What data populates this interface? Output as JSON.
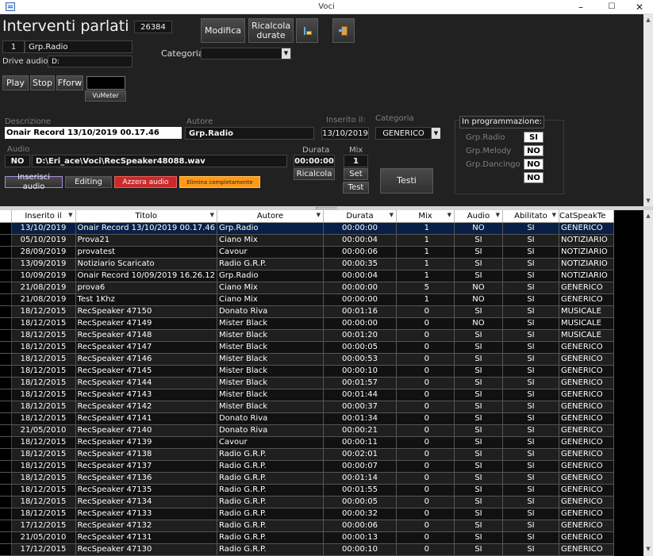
{
  "window": {
    "title": "Voci",
    "min_label": "–",
    "max_label": "☐",
    "close_label": "✕"
  },
  "header": {
    "title": "Interventi parlati",
    "count": "26384",
    "group_id": "1",
    "group_name": "Grp.Radio",
    "drive_label": "Drive audio:",
    "drive_value": "D:",
    "category_label": "Categoria:",
    "category_value": ""
  },
  "toolbar": {
    "edit_label": "Modifica",
    "recalc_label": "Ricalcola durate",
    "sort_icon": "sort-icon",
    "exit_icon": "exit-icon"
  },
  "player": {
    "play": "Play",
    "stop": "Stop",
    "fforw": "Fforw",
    "vumeter": "VuMeter"
  },
  "detail": {
    "description_label": "Descrizione",
    "description_value": "Onair Record 13/10/2019 00.17.46",
    "author_label": "Autore",
    "author_value": "Grp.Radio",
    "inserted_label": "Inserito il:",
    "inserted_value": "13/10/2019",
    "category_label": "Categoria",
    "category_value": "GENERICO",
    "audio_label": "Audio",
    "audio_flag": "NO",
    "audio_path": "D:\\Eri_ace\\Voci\\RecSpeaker48088.wav",
    "duration_label": "Durata",
    "duration_value": "00:00:00",
    "recalc_label": "Ricalcola",
    "mix_label": "Mix",
    "mix_value": "1",
    "set_label": "Set",
    "test_label": "Test",
    "tests_label": "Testi"
  },
  "actions": {
    "insert_audio": "Inserisci audio",
    "editing": "Editing",
    "reset_audio": "Azzera audio",
    "delete_all": "Elimina completamente"
  },
  "programming": {
    "title": "In programmazione:",
    "rows": [
      {
        "name": "Grp.Radio",
        "value": "SI"
      },
      {
        "name": "Grp.Melody",
        "value": "NO"
      },
      {
        "name": "Grp.Dancingo",
        "value": "NO"
      },
      {
        "name": "",
        "value": "NO"
      }
    ]
  },
  "grid": {
    "columns": [
      "Inserito il",
      "Titolo",
      "Autore",
      "Durata",
      "Mix",
      "Audio",
      "Abilitato",
      "CatSpeakTe"
    ],
    "rows": [
      [
        "13/10/2019",
        "Onair Record 13/10/2019 00.17.46",
        "Grp.Radio",
        "00:00:00",
        "1",
        "NO",
        "SI",
        "GENERICO"
      ],
      [
        "05/10/2019",
        "Prova21",
        "Ciano Mix",
        "00:00:04",
        "1",
        "SI",
        "SI",
        "NOTIZIARIO"
      ],
      [
        "28/09/2019",
        "provatest",
        "Cavour",
        "00:00:06",
        "1",
        "SI",
        "SI",
        "NOTIZIARIO"
      ],
      [
        "13/09/2019",
        "Notiziario Scaricato",
        "Radio G.R.P.",
        "00:00:35",
        "1",
        "SI",
        "SI",
        "NOTIZIARIO"
      ],
      [
        "10/09/2019",
        "Onair Record 10/09/2019 16.26.12",
        "Grp.Radio",
        "00:00:04",
        "1",
        "SI",
        "SI",
        "NOTIZIARIO"
      ],
      [
        "21/08/2019",
        "prova6",
        "Ciano Mix",
        "00:00:00",
        "5",
        "NO",
        "SI",
        "GENERICO"
      ],
      [
        "21/08/2019",
        "Test 1Khz",
        "Ciano Mix",
        "00:00:00",
        "1",
        "NO",
        "SI",
        "GENERICO"
      ],
      [
        "18/12/2015",
        "RecSpeaker 47150",
        "Donato Riva",
        "00:01:16",
        "0",
        "SI",
        "SI",
        "MUSICALE"
      ],
      [
        "18/12/2015",
        "RecSpeaker 47149",
        "Mister Black",
        "00:00:00",
        "0",
        "NO",
        "SI",
        "MUSICALE"
      ],
      [
        "18/12/2015",
        "RecSpeaker 47148",
        "Mister Black",
        "00:01:20",
        "0",
        "SI",
        "SI",
        "MUSICALE"
      ],
      [
        "18/12/2015",
        "RecSpeaker 47147",
        "Mister Black",
        "00:00:05",
        "0",
        "SI",
        "SI",
        "GENERICO"
      ],
      [
        "18/12/2015",
        "RecSpeaker 47146",
        "Mister Black",
        "00:00:53",
        "0",
        "SI",
        "SI",
        "GENERICO"
      ],
      [
        "18/12/2015",
        "RecSpeaker 47145",
        "Mister Black",
        "00:00:10",
        "0",
        "SI",
        "SI",
        "GENERICO"
      ],
      [
        "18/12/2015",
        "RecSpeaker 47144",
        "Mister Black",
        "00:01:57",
        "0",
        "SI",
        "SI",
        "GENERICO"
      ],
      [
        "18/12/2015",
        "RecSpeaker 47143",
        "Mister Black",
        "00:01:44",
        "0",
        "SI",
        "SI",
        "GENERICO"
      ],
      [
        "18/12/2015",
        "RecSpeaker 47142",
        "Mister Black",
        "00:00:37",
        "0",
        "SI",
        "SI",
        "GENERICO"
      ],
      [
        "18/12/2015",
        "RecSpeaker 47141",
        "Donato Riva",
        "00:01:34",
        "0",
        "SI",
        "SI",
        "GENERICO"
      ],
      [
        "21/05/2010",
        "RecSpeaker 47140",
        "Donato Riva",
        "00:00:21",
        "0",
        "SI",
        "SI",
        "GENERICO"
      ],
      [
        "18/12/2015",
        "RecSpeaker 47139",
        "Cavour",
        "00:00:11",
        "0",
        "SI",
        "SI",
        "GENERICO"
      ],
      [
        "18/12/2015",
        "RecSpeaker 47138",
        "Radio G.R.P.",
        "00:02:01",
        "0",
        "SI",
        "SI",
        "GENERICO"
      ],
      [
        "18/12/2015",
        "RecSpeaker 47137",
        "Radio G.R.P.",
        "00:00:07",
        "0",
        "SI",
        "SI",
        "GENERICO"
      ],
      [
        "18/12/2015",
        "RecSpeaker 47136",
        "Radio G.R.P.",
        "00:01:14",
        "0",
        "SI",
        "SI",
        "GENERICO"
      ],
      [
        "18/12/2015",
        "RecSpeaker 47135",
        "Radio G.R.P.",
        "00:01:55",
        "0",
        "SI",
        "SI",
        "GENERICO"
      ],
      [
        "18/12/2015",
        "RecSpeaker 47134",
        "Radio G.R.P.",
        "00:00:05",
        "0",
        "SI",
        "SI",
        "GENERICO"
      ],
      [
        "18/12/2015",
        "RecSpeaker 47133",
        "Radio G.R.P.",
        "00:00:32",
        "0",
        "SI",
        "SI",
        "GENERICO"
      ],
      [
        "17/12/2015",
        "RecSpeaker 47132",
        "Radio G.R.P.",
        "00:00:06",
        "0",
        "SI",
        "SI",
        "GENERICO"
      ],
      [
        "21/05/2010",
        "RecSpeaker 47131",
        "Radio G.R.P.",
        "00:00:13",
        "0",
        "SI",
        "SI",
        "GENERICO"
      ],
      [
        "17/12/2015",
        "RecSpeaker 47130",
        "Radio G.R.P.",
        "00:00:10",
        "0",
        "SI",
        "SI",
        "GENERICO"
      ]
    ]
  },
  "colors": {
    "insert_audio": "#7a4fc0",
    "reset_audio": "#cc2a2a",
    "delete_all": "#ff9a16",
    "selected_row": "#082045"
  }
}
